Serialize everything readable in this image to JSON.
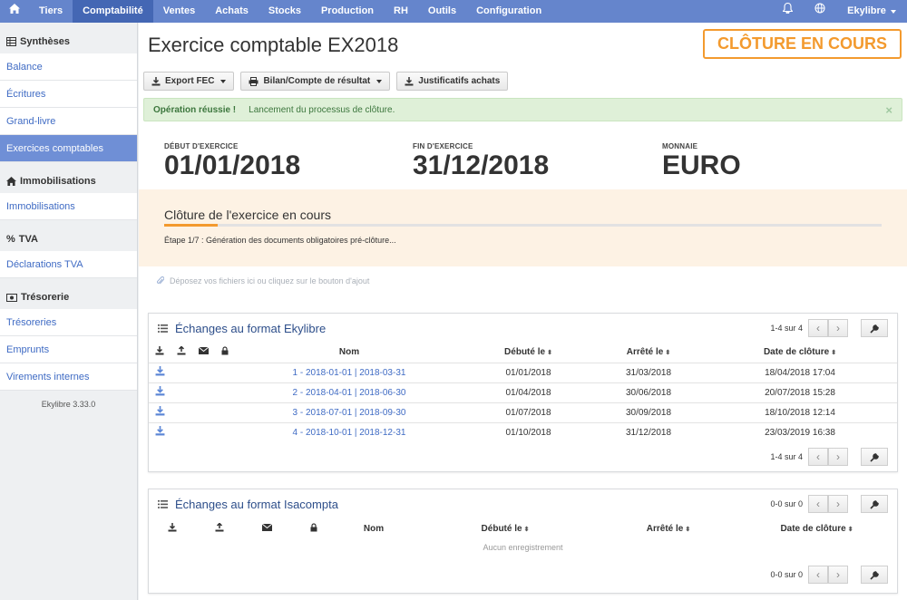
{
  "nav": {
    "items": [
      "Tiers",
      "Comptabilité",
      "Ventes",
      "Achats",
      "Stocks",
      "Production",
      "RH",
      "Outils",
      "Configuration"
    ],
    "user": "Ekylibre"
  },
  "sidebar": {
    "sections": [
      {
        "title": "Synthèses",
        "items": [
          "Balance",
          "Écritures",
          "Grand-livre",
          "Exercices comptables"
        ]
      },
      {
        "title": "Immobilisations",
        "items": [
          "Immobilisations"
        ]
      },
      {
        "title": "TVA",
        "items": [
          "Déclarations TVA"
        ]
      },
      {
        "title": "Trésorerie",
        "items": [
          "Trésoreries",
          "Emprunts",
          "Virements internes"
        ]
      }
    ],
    "version": "Ekylibre 3.33.0"
  },
  "page": {
    "title": "Exercice comptable EX2018",
    "status": "CLÔTURE EN COURS",
    "toolbar": {
      "export": "Export FEC",
      "bilan": "Bilan/Compte de résultat",
      "justificatifs": "Justificatifs achats"
    },
    "alert": {
      "title": "Opération réussie !",
      "message": "Lancement du processus de clôture."
    },
    "summary": {
      "start_label": "DÉBUT D'EXERCICE",
      "start_value": "01/01/2018",
      "end_label": "FIN D'EXERCICE",
      "end_value": "31/12/2018",
      "currency_label": "MONNAIE",
      "currency_value": "EURO"
    },
    "closing": {
      "title": "Clôture de l'exercice en cours",
      "step": "Étape 1/7 : Génération des documents obligatoires pré-clôture...",
      "progress": 0.075
    },
    "dropzone": "Déposez vos fichiers ici ou cliquez sur le bouton d'ajout"
  },
  "ekylibre_panel": {
    "title": "Échanges au format Ekylibre",
    "pager": "1-4 sur 4",
    "columns": [
      "Nom",
      "Débuté le",
      "Arrêté le",
      "Date de clôture"
    ],
    "rows": [
      {
        "name": "1 - 2018-01-01 | 2018-03-31",
        "start": "01/01/2018",
        "end": "31/03/2018",
        "close": "18/04/2018 17:04"
      },
      {
        "name": "2 - 2018-04-01 | 2018-06-30",
        "start": "01/04/2018",
        "end": "30/06/2018",
        "close": "20/07/2018 15:28"
      },
      {
        "name": "3 - 2018-07-01 | 2018-09-30",
        "start": "01/07/2018",
        "end": "30/09/2018",
        "close": "18/10/2018 12:14"
      },
      {
        "name": "4 - 2018-10-01 | 2018-12-31",
        "start": "01/10/2018",
        "end": "31/12/2018",
        "close": "23/03/2019 16:38"
      }
    ]
  },
  "isacompta_panel": {
    "title": "Échanges au format Isacompta",
    "pager": "0-0 sur 0",
    "columns": [
      "Nom",
      "Débuté le",
      "Arrêté le",
      "Date de clôture"
    ],
    "empty": "Aucun enregistrement"
  },
  "colors": {
    "nav": "#6585cc",
    "accent": "#f39a2e",
    "link": "#3f6bc4"
  }
}
